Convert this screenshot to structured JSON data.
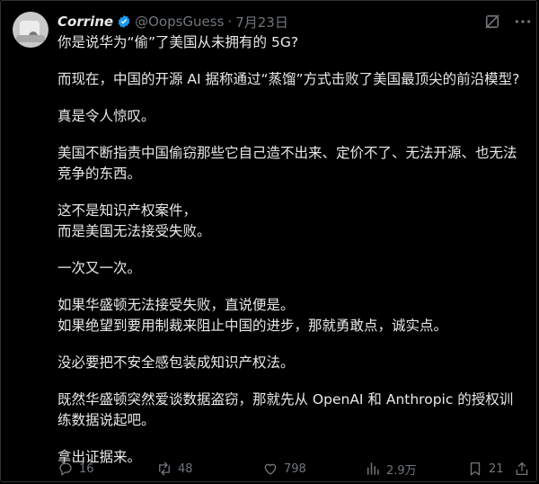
{
  "tweet": {
    "author_name": "Corrine",
    "handle": "@OopsGuess",
    "separator": "·",
    "date": "7月23日",
    "paragraphs": [
      "你是说华为“偷”了美国从未拥有的 5G?",
      "而现在，中国的开源 AI 据称通过“蒸馏”方式击败了美国最顶尖的前沿模型?",
      "真是令人惊叹。",
      "美国不断指责中国偷窃那些它自己造不出来、定价不了、无法开源、也无法竞争的东西。",
      "这不是知识产权案件，\n而是美国无法接受失败。",
      "一次又一次。",
      "如果华盛顿无法接受失败，直说便是。\n如果绝望到要用制裁来阻止中国的进步，那就勇敢点，诚实点。",
      "没必要把不安全感包装成知识产权法。",
      "既然华盛顿突然爱谈数据盗窃，那就先从 OpenAI 和 Anthropic 的授权训练数据说起吧。",
      "拿出证据来。"
    ]
  },
  "actions": {
    "replies": "16",
    "retweets": "48",
    "likes": "798",
    "views": "2.9万",
    "bookmarks": "21"
  },
  "colors": {
    "background": "#000000",
    "text": "#e7e9ea",
    "muted": "#71767b",
    "verified": "#1d9bf0"
  },
  "icons": [
    "verified-badge-icon",
    "grok-icon",
    "more-icon",
    "reply-icon",
    "retweet-icon",
    "like-icon",
    "views-icon",
    "bookmark-icon",
    "share-icon"
  ]
}
